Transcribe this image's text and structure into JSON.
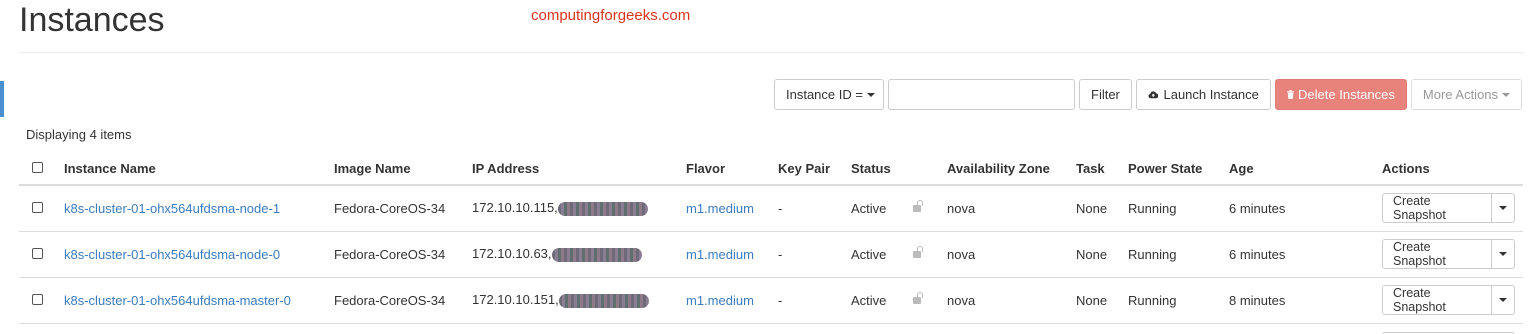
{
  "page": {
    "title": "Instances",
    "watermark": "computingforgeeks.com"
  },
  "toolbar": {
    "filter_select_label": "Instance ID =",
    "filter_input_value": "",
    "filter_button": "Filter",
    "launch_button": "Launch Instance",
    "delete_button": "Delete Instances",
    "more_actions_button": "More Actions"
  },
  "table": {
    "count_text": "Displaying 4 items",
    "headers": {
      "name": "Instance Name",
      "image": "Image Name",
      "ip": "IP Address",
      "flavor": "Flavor",
      "keypair": "Key Pair",
      "status": "Status",
      "az": "Availability Zone",
      "task": "Task",
      "power": "Power State",
      "age": "Age",
      "actions": "Actions"
    },
    "rows": [
      {
        "name": "k8s-cluster-01-ohx564ufdsma-node-1",
        "image": "Fedora-CoreOS-34",
        "ip": "172.10.10.115,",
        "flavor": "m1.medium",
        "keypair": "-",
        "status": "Active",
        "az": "nova",
        "task": "None",
        "power": "Running",
        "age": "6 minutes",
        "action": "Create Snapshot"
      },
      {
        "name": "k8s-cluster-01-ohx564ufdsma-node-0",
        "image": "Fedora-CoreOS-34",
        "ip": "172.10.10.63,",
        "flavor": "m1.medium",
        "keypair": "-",
        "status": "Active",
        "az": "nova",
        "task": "None",
        "power": "Running",
        "age": "6 minutes",
        "action": "Create Snapshot"
      },
      {
        "name": "k8s-cluster-01-ohx564ufdsma-master-0",
        "image": "Fedora-CoreOS-34",
        "ip": "172.10.10.151,",
        "flavor": "m1.medium",
        "keypair": "-",
        "status": "Active",
        "az": "nova",
        "task": "None",
        "power": "Running",
        "age": "8 minutes",
        "action": "Create Snapshot"
      }
    ]
  },
  "colors": {
    "link": "#3a7cbf",
    "danger": "#e8837c",
    "watermark": "#d9331f",
    "accent": "#4a8fd0"
  }
}
